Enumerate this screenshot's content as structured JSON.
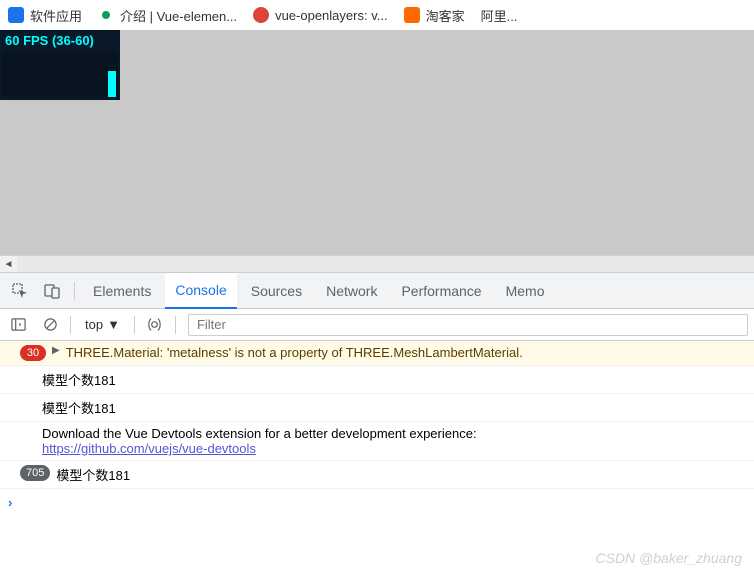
{
  "bookmarks": [
    {
      "icon": "blue",
      "label": "软件应用"
    },
    {
      "icon": "green",
      "label": "介绍 | Vue-elemen..."
    },
    {
      "icon": "red",
      "label": "vue-openlayers: v..."
    },
    {
      "icon": "orange",
      "label": "淘客家"
    },
    {
      "icon": "none",
      "label": "阿里..."
    }
  ],
  "fps": {
    "text": "60 FPS (36-60)"
  },
  "devtools": {
    "tabs": [
      "Elements",
      "Console",
      "Sources",
      "Network",
      "Performance",
      "Memo"
    ],
    "active_index": 1,
    "context": "top",
    "filter_placeholder": "Filter"
  },
  "logs": [
    {
      "type": "warn",
      "badge": "30",
      "expand": true,
      "text": "THREE.Material: 'metalness' is not a property of THREE.MeshLambertMaterial."
    },
    {
      "type": "log",
      "text": "模型个数181"
    },
    {
      "type": "log",
      "text": "模型个数181"
    },
    {
      "type": "log",
      "text_pre": "Download the Vue Devtools extension for a better development experience:",
      "link": "https://github.com/vuejs/vue-devtools"
    },
    {
      "type": "log",
      "badge": "705",
      "text": "模型个数181"
    }
  ],
  "watermark": "CSDN @baker_zhuang"
}
